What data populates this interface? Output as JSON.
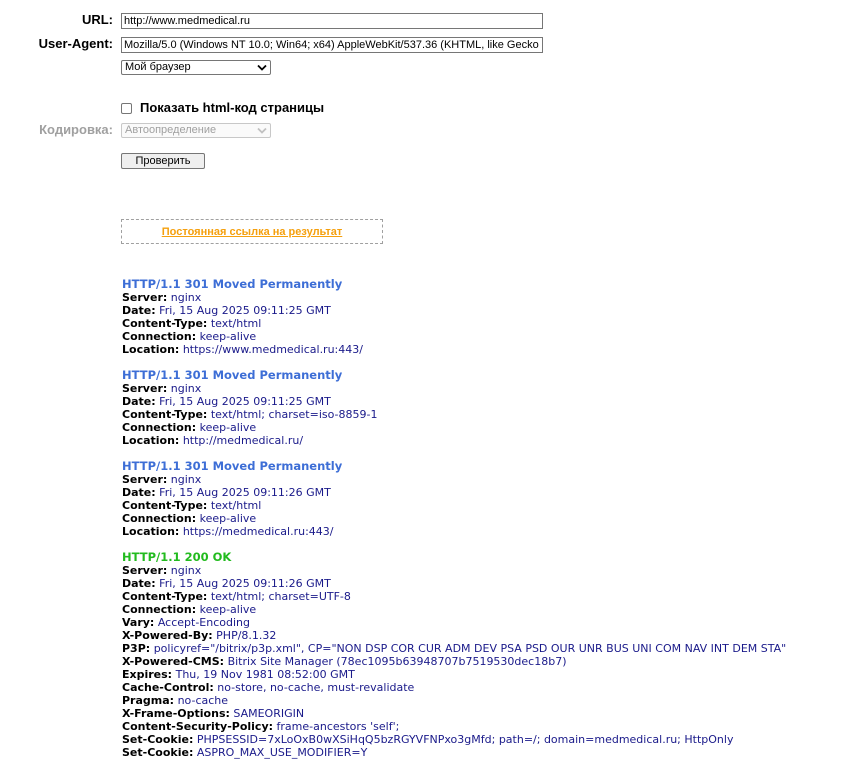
{
  "form": {
    "url_label": "URL:",
    "url_value": "http://www.medmedical.ru",
    "ua_label": "User-Agent:",
    "ua_value": "Mozilla/5.0 (Windows NT 10.0; Win64; x64) AppleWebKit/537.36 (KHTML, like Gecko",
    "browser_select": "Мой браузер",
    "show_html_label": "Показать html-код страницы",
    "show_html_checked": false,
    "encoding_label": "Кодировка:",
    "encoding_select": "Автоопределение",
    "encoding_disabled": true,
    "submit_label": "Проверить"
  },
  "permalink": {
    "text": "Постоянная ссылка на результат"
  },
  "responses": [
    {
      "status": "HTTP/1.1 301 Moved Permanently",
      "ok": false,
      "headers": [
        {
          "name": "Server:",
          "value": "nginx"
        },
        {
          "name": "Date:",
          "value": "Fri, 15 Aug 2025 09:11:25 GMT"
        },
        {
          "name": "Content-Type:",
          "value": "text/html"
        },
        {
          "name": "Connection:",
          "value": "keep-alive"
        },
        {
          "name": "Location:",
          "value": "https://www.medmedical.ru:443/"
        }
      ]
    },
    {
      "status": "HTTP/1.1 301 Moved Permanently",
      "ok": false,
      "headers": [
        {
          "name": "Server:",
          "value": "nginx"
        },
        {
          "name": "Date:",
          "value": "Fri, 15 Aug 2025 09:11:25 GMT"
        },
        {
          "name": "Content-Type:",
          "value": "text/html; charset=iso-8859-1"
        },
        {
          "name": "Connection:",
          "value": "keep-alive"
        },
        {
          "name": "Location:",
          "value": "http://medmedical.ru/"
        }
      ]
    },
    {
      "status": "HTTP/1.1 301 Moved Permanently",
      "ok": false,
      "headers": [
        {
          "name": "Server:",
          "value": "nginx"
        },
        {
          "name": "Date:",
          "value": "Fri, 15 Aug 2025 09:11:26 GMT"
        },
        {
          "name": "Content-Type:",
          "value": "text/html"
        },
        {
          "name": "Connection:",
          "value": "keep-alive"
        },
        {
          "name": "Location:",
          "value": "https://medmedical.ru:443/"
        }
      ]
    },
    {
      "status": "HTTP/1.1 200 OK",
      "ok": true,
      "headers": [
        {
          "name": "Server:",
          "value": "nginx"
        },
        {
          "name": "Date:",
          "value": "Fri, 15 Aug 2025 09:11:26 GMT"
        },
        {
          "name": "Content-Type:",
          "value": "text/html; charset=UTF-8"
        },
        {
          "name": "Connection:",
          "value": "keep-alive"
        },
        {
          "name": "Vary:",
          "value": "Accept-Encoding"
        },
        {
          "name": "X-Powered-By:",
          "value": "PHP/8.1.32"
        },
        {
          "name": "P3P:",
          "value": "policyref=\"/bitrix/p3p.xml\", CP=\"NON DSP COR CUR ADM DEV PSA PSD OUR UNR BUS UNI COM NAV INT DEM STA\""
        },
        {
          "name": "X-Powered-CMS:",
          "value": "Bitrix Site Manager (78ec1095b63948707b7519530dec18b7)"
        },
        {
          "name": "Expires:",
          "value": "Thu, 19 Nov 1981 08:52:00 GMT"
        },
        {
          "name": "Cache-Control:",
          "value": "no-store, no-cache, must-revalidate"
        },
        {
          "name": "Pragma:",
          "value": "no-cache"
        },
        {
          "name": "X-Frame-Options:",
          "value": "SAMEORIGIN"
        },
        {
          "name": "Content-Security-Policy:",
          "value": "frame-ancestors 'self';"
        },
        {
          "name": "Set-Cookie:",
          "value": "PHPSESSID=7xLoOxB0wXSiHqQ5bzRGYVFNPxo3gMfd; path=/; domain=medmedical.ru; HttpOnly"
        },
        {
          "name": "Set-Cookie:",
          "value": "ASPRO_MAX_USE_MODIFIER=Y"
        }
      ]
    }
  ],
  "colors": {
    "status_redirect": "#3d6ed6",
    "status_ok": "#22bb1e",
    "header_value": "#1a1a8a",
    "permalink": "#f5a00e"
  },
  "icons": {
    "select_arrow": "chevron-down-icon"
  }
}
